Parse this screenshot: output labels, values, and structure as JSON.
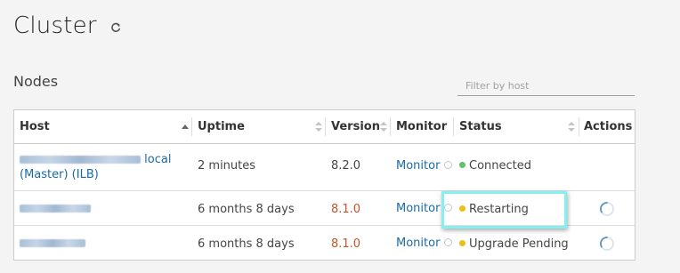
{
  "page": {
    "title": "Cluster",
    "refresh_icon": "refresh-icon"
  },
  "nodes": {
    "section_title": "Nodes",
    "filter_placeholder": "Filter by host",
    "columns": {
      "host": "Host",
      "uptime": "Uptime",
      "version": "Version",
      "monitor": "Monitor",
      "status": "Status",
      "actions": "Actions"
    },
    "rows": [
      {
        "host_suffix": "local",
        "host_line2": "(Master) (ILB)",
        "uptime": "2 minutes",
        "version": "8.2.0",
        "monitor": "Monitor",
        "status": "Connected",
        "status_color": "#5cc46a"
      },
      {
        "uptime": "6 months 8 days",
        "version": "8.1.0",
        "monitor": "Monitor",
        "status": "Restarting",
        "status_color": "#e8c113"
      },
      {
        "uptime": "6 months 8 days",
        "version": "8.1.0",
        "monitor": "Monitor",
        "status": "Upgrade Pending",
        "status_color": "#e8c113"
      }
    ]
  },
  "colors": {
    "link": "#1a6aa8",
    "version_outdated": "#c45427",
    "highlight": "#86f0f0"
  }
}
